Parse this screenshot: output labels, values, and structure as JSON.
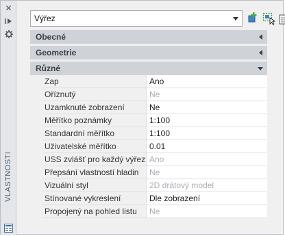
{
  "strip": {
    "title": "VLASTNOSTI"
  },
  "selector": {
    "value": "Výřez"
  },
  "sections": {
    "general": "Obecné",
    "geometry": "Geometrie",
    "misc": "Různé"
  },
  "properties": [
    {
      "name": "Zap",
      "value": "Ano",
      "disabled": false
    },
    {
      "name": "Oříznutý",
      "value": "Ne",
      "disabled": true
    },
    {
      "name": "Uzamknuté zobrazení",
      "value": "Ne",
      "disabled": false
    },
    {
      "name": "Měřítko poznámky",
      "value": "1:100",
      "disabled": false
    },
    {
      "name": "Standardní měřítko",
      "value": "1:100",
      "disabled": false
    },
    {
      "name": "Uživatelské měřítko",
      "value": "0.01",
      "disabled": false
    },
    {
      "name": "USS zvlášť pro každý výřez",
      "value": "Ano",
      "disabled": true
    },
    {
      "name": "Přepsání vlastností hladin",
      "value": "Ne",
      "disabled": true
    },
    {
      "name": "Vizuální styl",
      "value": "2D drátový model",
      "disabled": true
    },
    {
      "name": "Stínované vykreslení",
      "value": "Dle zobrazení",
      "disabled": false
    },
    {
      "name": "Propojený na pohled listu",
      "value": "Ne",
      "disabled": true
    }
  ],
  "colors": {
    "section_bg": "#cfd3d8",
    "disabled_text": "#a9adb2"
  }
}
